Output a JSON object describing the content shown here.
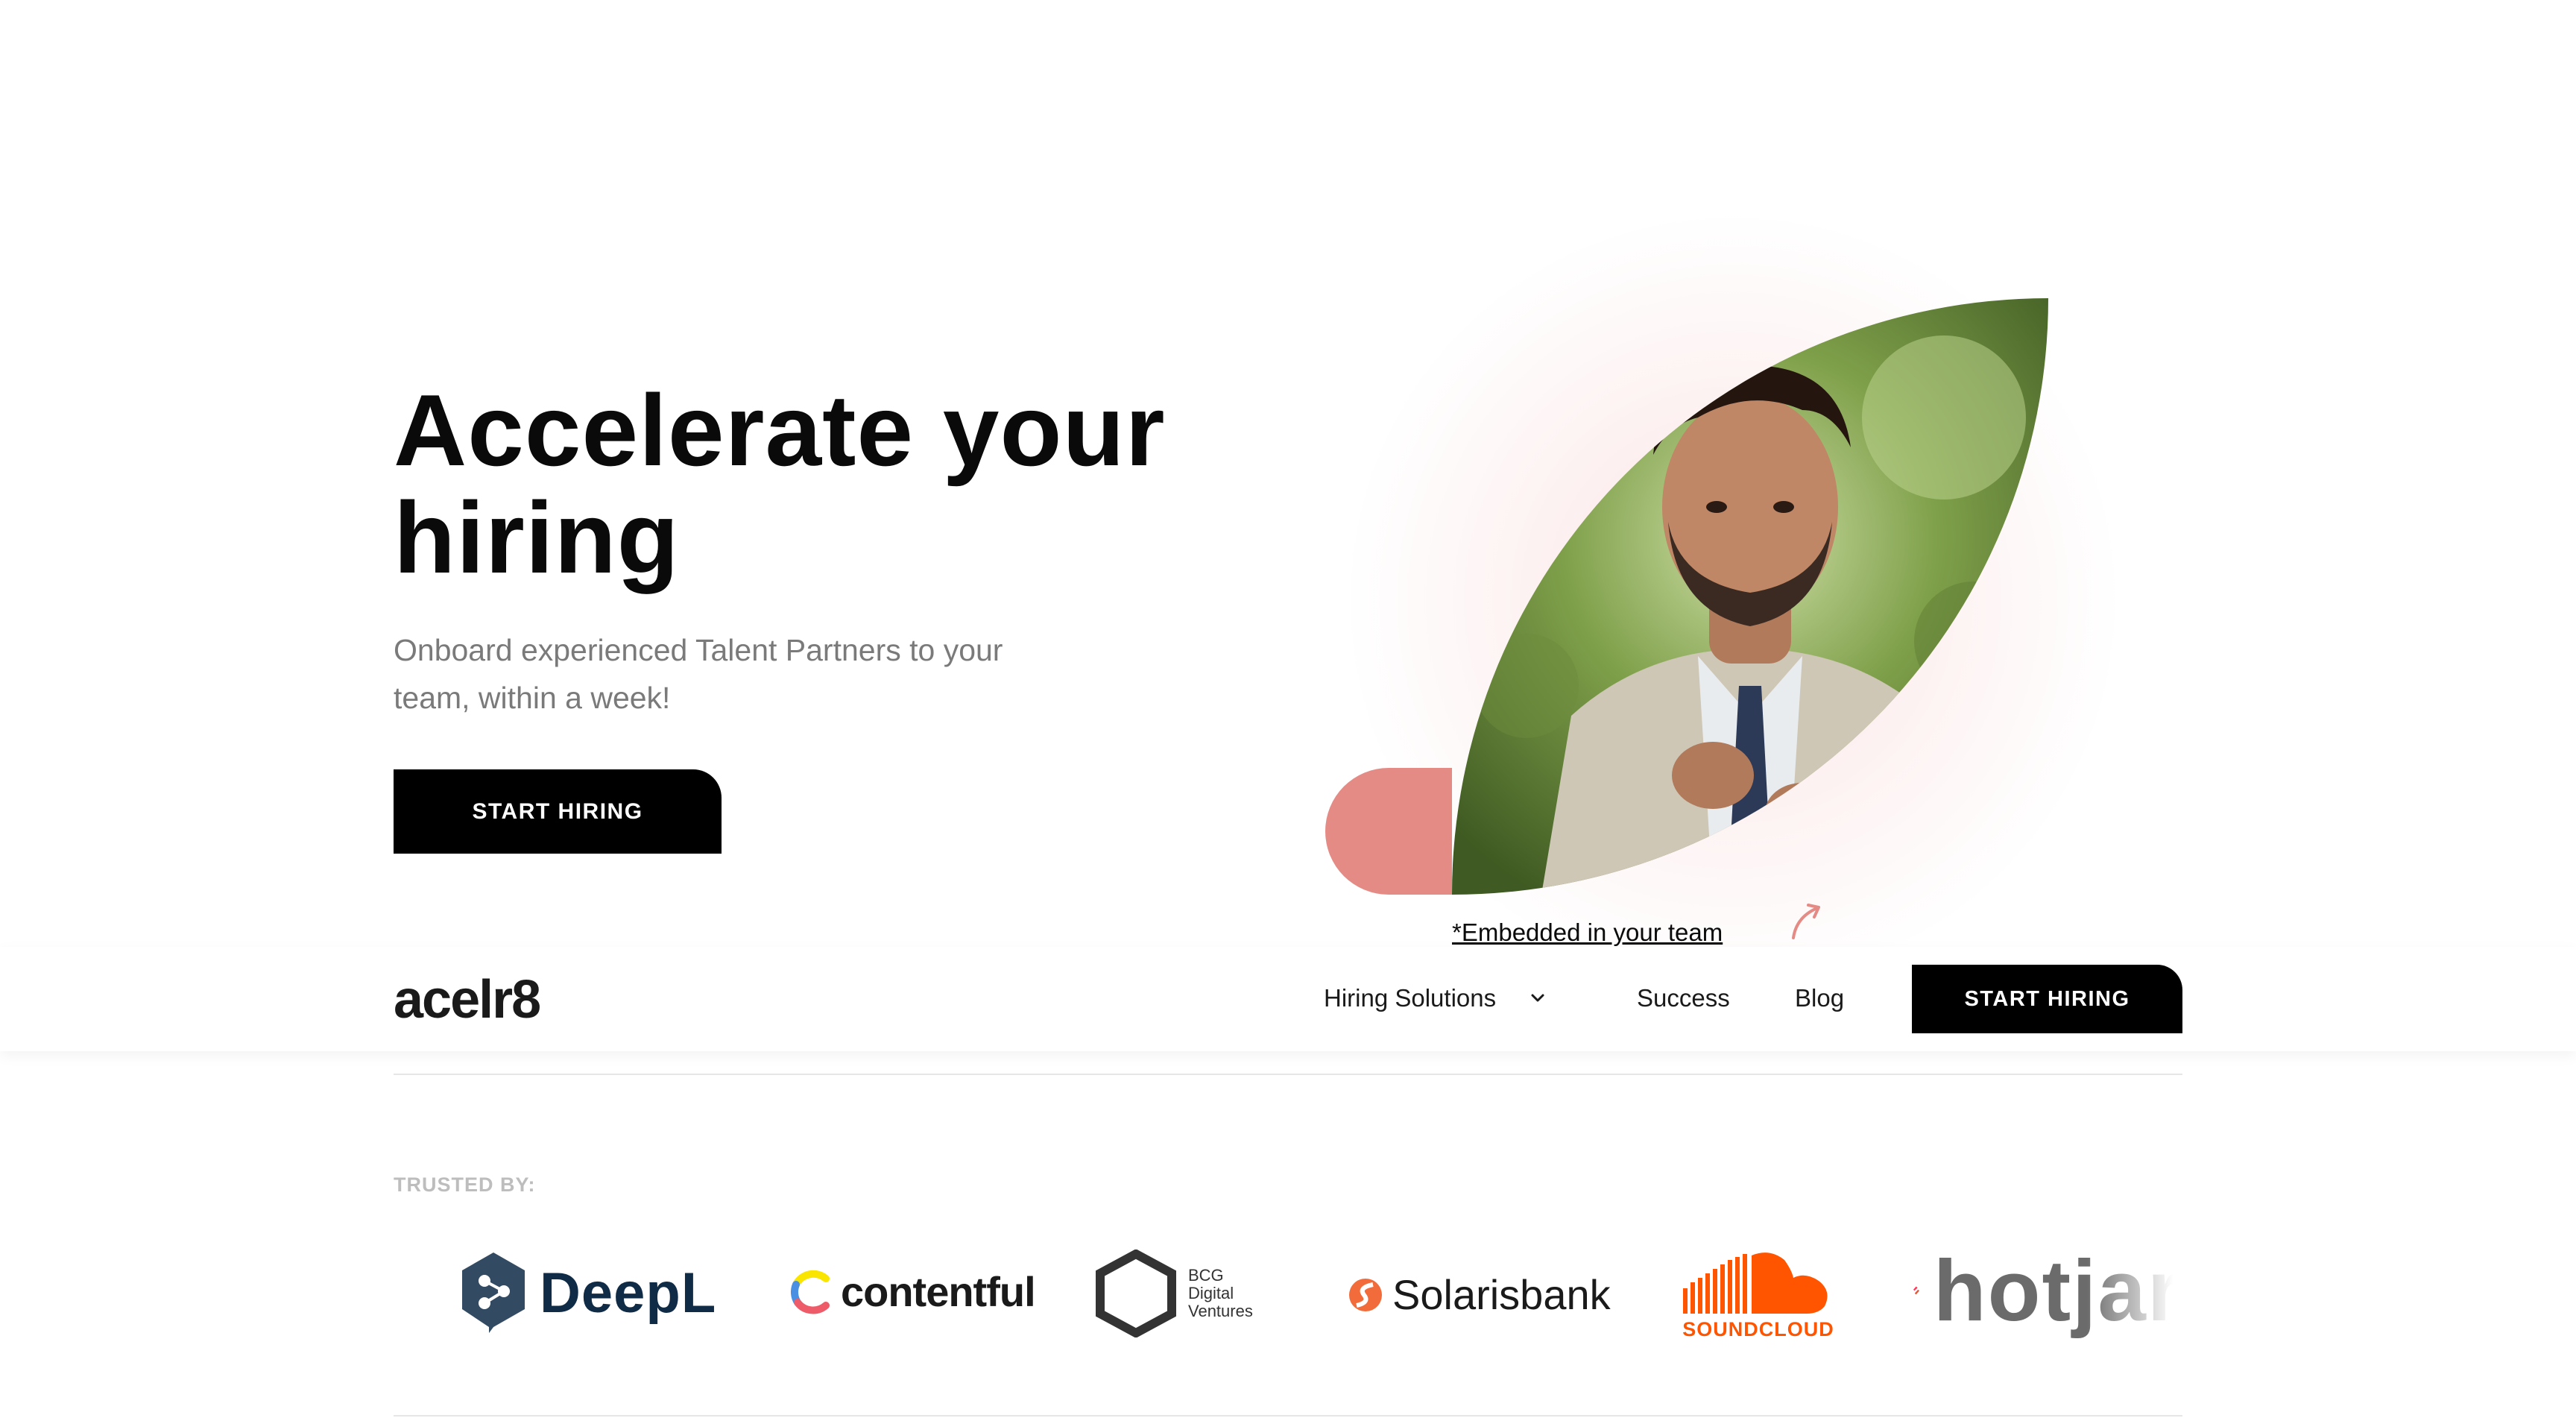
{
  "hero": {
    "title": "Accelerate your hiring",
    "subtitle": "Onboard experienced Talent Partners to your team, within a week!",
    "cta_label": "START HIRING",
    "photo_caption": "*Embedded in your team"
  },
  "nav": {
    "logo_text": "acelr8",
    "items": [
      {
        "label": "Hiring Solutions",
        "icon": "chevron-down-icon"
      },
      {
        "label": "Success"
      },
      {
        "label": "Blog"
      }
    ],
    "cta_label": "START HIRING"
  },
  "trusted": {
    "label": "TRUSTED BY:",
    "logos": [
      {
        "name": "DeepL"
      },
      {
        "name": "contentful"
      },
      {
        "name": "BCG",
        "line2": "Digital",
        "line3": "Ventures"
      },
      {
        "name": "Solarisbank"
      },
      {
        "name": "SOUNDCLOUD"
      },
      {
        "name": "hotjar"
      }
    ]
  },
  "colors": {
    "accent_pink": "#e58b86",
    "button_bg": "#000000",
    "subtitle_gray": "#7a7a7a",
    "soundcloud_orange": "#ff5500",
    "hotjar_red": "#fd3a5c"
  }
}
